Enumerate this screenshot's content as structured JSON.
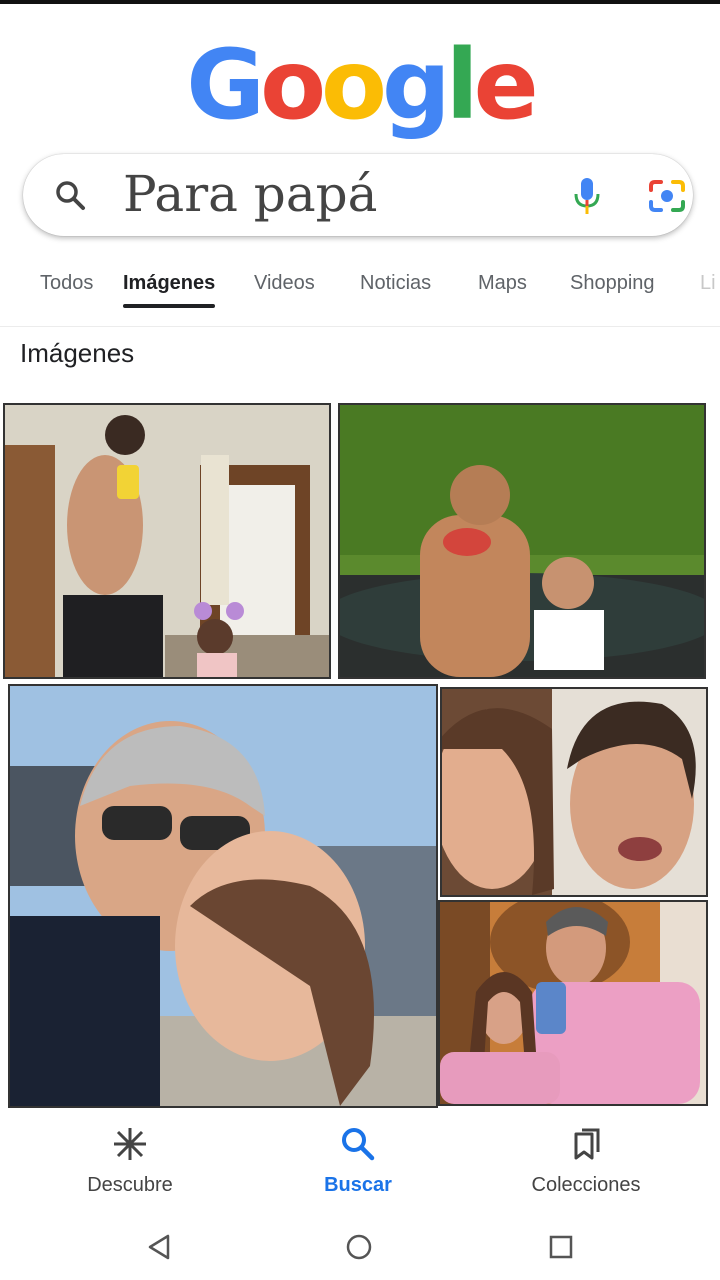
{
  "logo": {
    "letters": [
      {
        "char": "G",
        "color": "#4285F4"
      },
      {
        "char": "o",
        "color": "#EA4335"
      },
      {
        "char": "o",
        "color": "#FBBC05"
      },
      {
        "char": "g",
        "color": "#4285F4"
      },
      {
        "char": "l",
        "color": "#34A853"
      },
      {
        "char": "e",
        "color": "#EA4335"
      }
    ]
  },
  "search": {
    "query": "Para papá",
    "icons": [
      "search-icon",
      "microphone-icon",
      "google-lens-icon"
    ]
  },
  "tabs": [
    {
      "label": "Todos",
      "active": false
    },
    {
      "label": "Imágenes",
      "active": true
    },
    {
      "label": "Videos",
      "active": false
    },
    {
      "label": "Noticias",
      "active": false
    },
    {
      "label": "Maps",
      "active": false
    },
    {
      "label": "Shopping",
      "active": false
    },
    {
      "label": "Li",
      "active": false
    }
  ],
  "section": {
    "title": "Imágenes"
  },
  "bottom_nav": [
    {
      "label": "Descubre",
      "icon": "asterisk-icon",
      "active": false
    },
    {
      "label": "Buscar",
      "icon": "search-icon",
      "active": true
    },
    {
      "label": "Colecciones",
      "icon": "collections-icon",
      "active": false
    }
  ],
  "system_nav": [
    "back-icon",
    "home-icon",
    "recents-icon"
  ],
  "colors": {
    "accent": "#1a73e8",
    "text": "#202124",
    "muted": "#5f6368"
  }
}
